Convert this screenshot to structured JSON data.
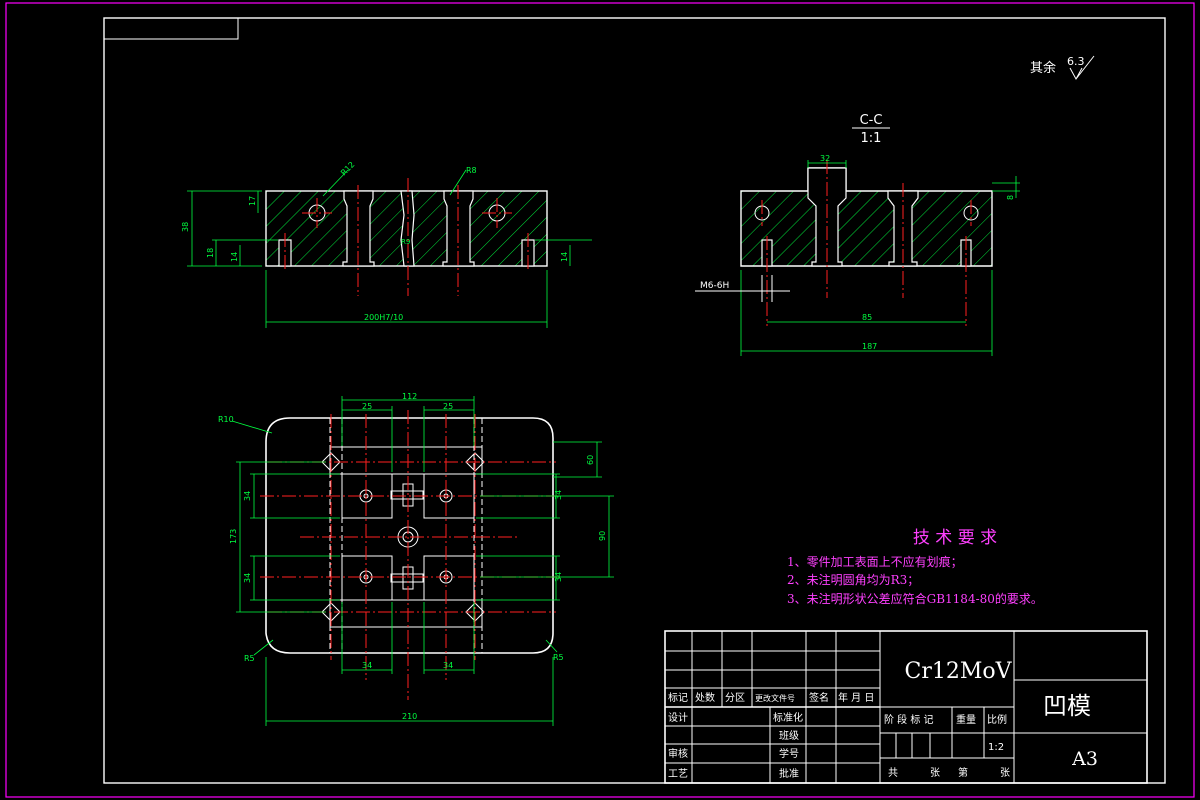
{
  "surface_symbol": {
    "prefix": "其余",
    "value": "6.3"
  },
  "section_view": {
    "name": "C-C",
    "scale": "1:1"
  },
  "front_view": {
    "dim_total": "200H7/10",
    "dim_height": "38",
    "dim_top": "17",
    "dim_left_a": "18",
    "dim_left_b": "14",
    "dim_right": "14",
    "callout_r": "R12",
    "callout_r2": "R8",
    "callout_mid": "R9"
  },
  "side_view": {
    "thread": "M6-6H",
    "dim_inner": "85",
    "dim_total": "187",
    "dim_top": "32",
    "dim_right": "8"
  },
  "plan_view": {
    "dim_top": "112",
    "dim_top_left": "25",
    "dim_top_right": "25",
    "dim_bottom_left": "34",
    "dim_bottom_right": "34",
    "dim_total": "210",
    "dim_left": "173",
    "dim_left_a": "34",
    "dim_left_b": "34",
    "dim_right_top": "60",
    "dim_right": "90",
    "dim_right_a": "34",
    "dim_right_b": "34",
    "corner_r": "R10",
    "corner_bl": "R5",
    "corner_br": "R5"
  },
  "tech_requirements": {
    "title": "技 术 要 求",
    "items": [
      "1、零件加工表面上不应有划痕；",
      "2、未注明圆角均为R3；",
      "3、未注明形状公差应符合GB1184-80的要求。"
    ]
  },
  "title_block": {
    "material": "Cr12MoV",
    "part_name": "凹模",
    "sheet_size": "A3",
    "scale_value": "1:2",
    "hdr_mark": "标记",
    "hdr_count": "处数",
    "hdr_zone": "分区",
    "hdr_doc": "更改文件号",
    "hdr_sign": "签名",
    "hdr_date": "年 月 日",
    "row_design": "设计",
    "row_std": "标准化",
    "row_class": "班级",
    "row_review": "审核",
    "row_id": "学号",
    "row_process": "工艺",
    "row_approve": "批准",
    "stage_mark": "阶 段 标 记",
    "weight": "重量",
    "scale": "比例",
    "total": "共",
    "sheets": "张",
    "nth": "第",
    "sheet2": "张"
  },
  "colors": {
    "background": "#000000",
    "frame": "#ff00ff",
    "outline": "#ffffff",
    "hatch": "#00ff40",
    "centerline": "#ff2020",
    "notes": "#ff40ff"
  }
}
